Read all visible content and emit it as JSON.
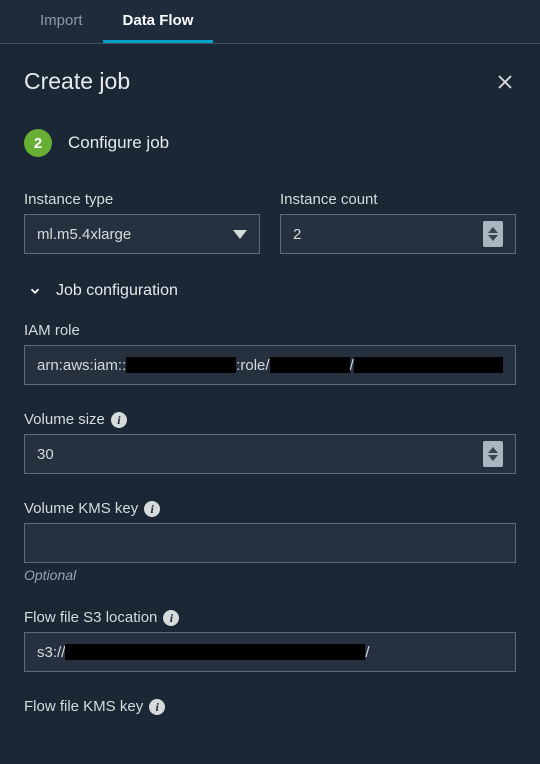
{
  "tabs": {
    "import": "Import",
    "dataflow": "Data Flow"
  },
  "header": {
    "title": "Create job"
  },
  "step": {
    "number": "2",
    "title": "Configure job"
  },
  "fields": {
    "instanceType": {
      "label": "Instance type",
      "value": "ml.m5.4xlarge"
    },
    "instanceCount": {
      "label": "Instance count",
      "value": "2"
    }
  },
  "jobConfig": {
    "toggleLabel": "Job configuration",
    "iamRole": {
      "label": "IAM role",
      "prefix": "arn:aws:iam::",
      "mid": ":role/",
      "sep": "/"
    },
    "volumeSize": {
      "label": "Volume size",
      "value": "30"
    },
    "volumeKms": {
      "label": "Volume KMS key",
      "value": "",
      "helper": "Optional"
    },
    "flowS3": {
      "label": "Flow file S3 location",
      "prefix": "s3://",
      "sep": "/"
    },
    "flowKms": {
      "label": "Flow file KMS key"
    }
  }
}
